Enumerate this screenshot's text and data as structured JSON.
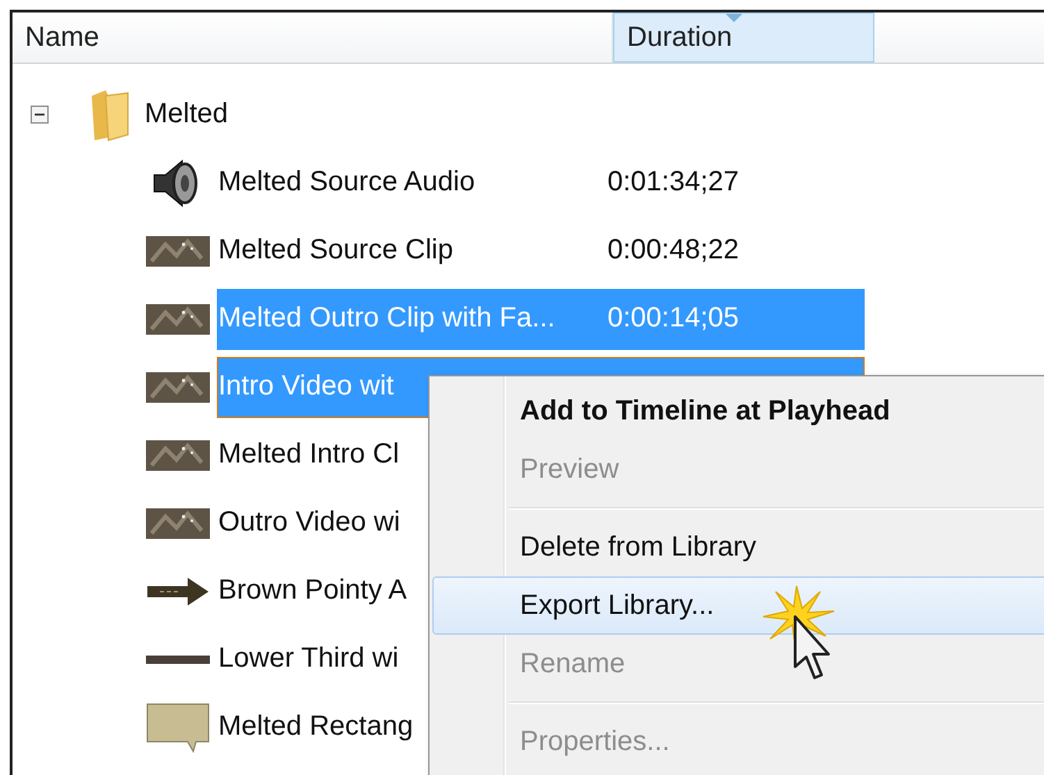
{
  "columns": [
    {
      "label": "Name",
      "sorted": false
    },
    {
      "label": "Duration",
      "sorted": true
    }
  ],
  "tree": {
    "name": "Melted",
    "expanded": true,
    "children": [
      {
        "kind": "audio",
        "name": "Melted Source Audio",
        "duration": "0:01:34;27",
        "selected": false,
        "focused": false
      },
      {
        "kind": "video",
        "name": "Melted Source Clip",
        "duration": "0:00:48;22",
        "selected": false,
        "focused": false
      },
      {
        "kind": "video",
        "name": "Melted Outro Clip with Fa...",
        "duration": "0:00:14;05",
        "selected": true,
        "focused": false
      },
      {
        "kind": "video",
        "name": "Intro Video wit",
        "selected": true,
        "focused": true
      },
      {
        "kind": "video",
        "name": "Melted Intro Cl",
        "selected": false,
        "focused": false
      },
      {
        "kind": "video",
        "name": "Outro Video wi",
        "selected": false,
        "focused": false
      },
      {
        "kind": "arrow",
        "name": "Brown Pointy A",
        "selected": false,
        "focused": false
      },
      {
        "kind": "line",
        "name": "Lower Third wi",
        "selected": false,
        "focused": false
      },
      {
        "kind": "callout",
        "name": "Melted Rectang",
        "selected": false,
        "focused": false
      }
    ]
  },
  "context_menu": [
    {
      "kind": "item",
      "label": "Add to Timeline at Playhead",
      "default": true,
      "disabled": false,
      "highlighted": false
    },
    {
      "kind": "item",
      "label": "Preview",
      "default": false,
      "disabled": true,
      "highlighted": false
    },
    {
      "kind": "separator"
    },
    {
      "kind": "item",
      "label": "Delete from Library",
      "default": false,
      "disabled": false,
      "highlighted": false
    },
    {
      "kind": "item",
      "label": "Export Library...",
      "default": false,
      "disabled": false,
      "highlighted": true
    },
    {
      "kind": "item",
      "label": "Rename",
      "default": false,
      "disabled": true,
      "highlighted": false
    },
    {
      "kind": "separator"
    },
    {
      "kind": "item",
      "label": "Properties...",
      "default": false,
      "disabled": true,
      "highlighted": false
    }
  ]
}
